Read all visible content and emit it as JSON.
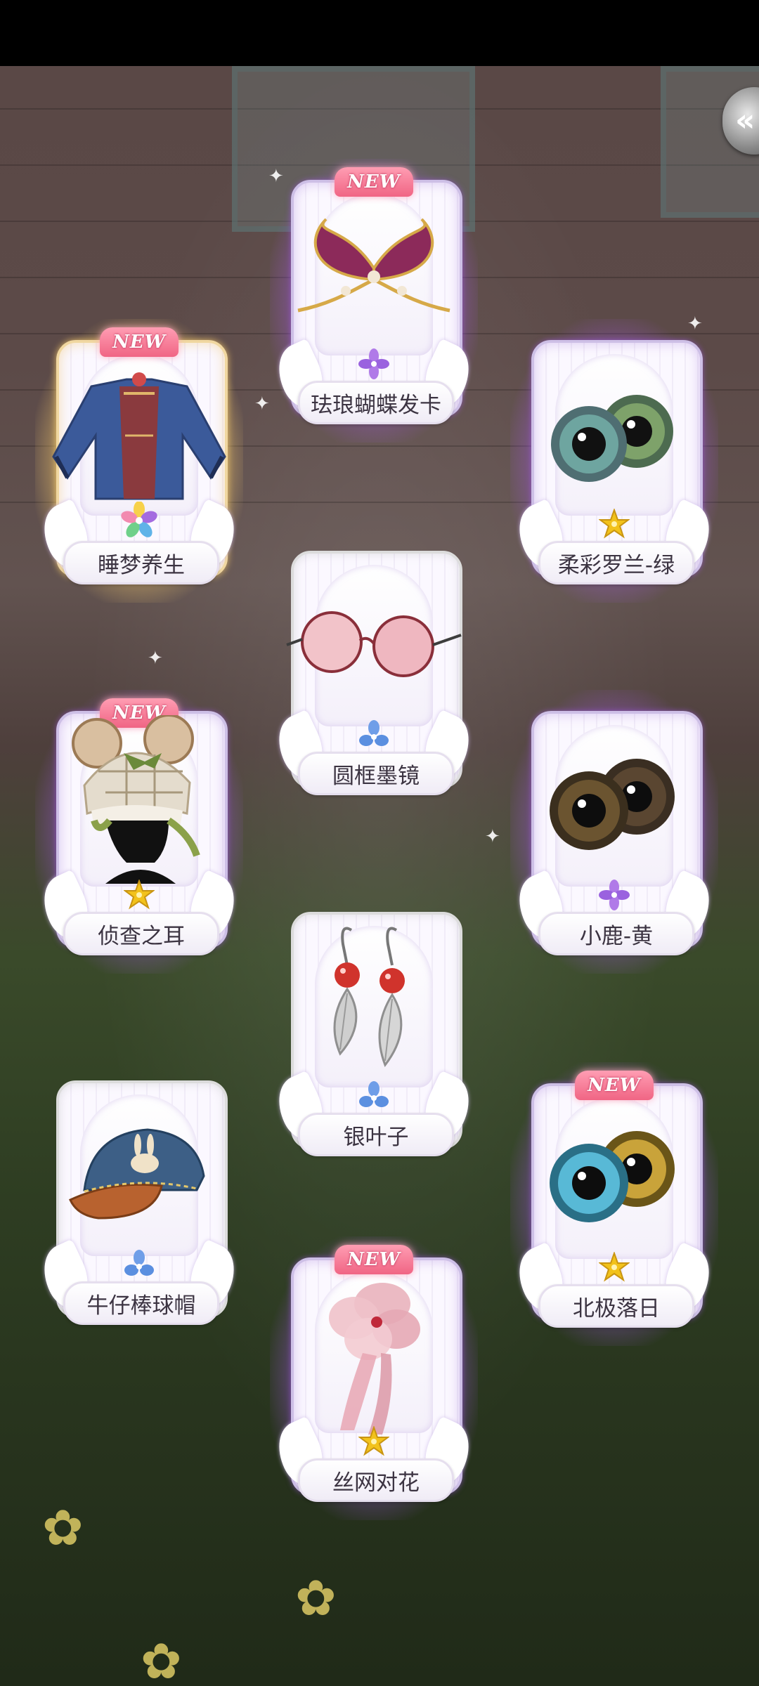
{
  "screen": "item-reward-results",
  "colors": {
    "rarity_purple": "#a86be6",
    "rarity_blue": "#5b8fe0",
    "rarity_gold": "#f2c21b",
    "new_badge": "#f06584",
    "glow_purple": "#b56ef5",
    "glow_gold": "#ffd36a"
  },
  "back_button": {
    "icon": "double-chevron-left-icon"
  },
  "items": [
    {
      "name": "睡梦养生",
      "new": "NEW",
      "rarity": "rainbow-flower-icon",
      "art": "blue-robe-outfit"
    },
    {
      "name": "珐琅蝴蝶发卡",
      "new": "NEW",
      "rarity": "purple-flower-icon",
      "art": "butterfly-hairpin"
    },
    {
      "name": "柔彩罗兰-绿",
      "new": "",
      "rarity": "gold-star-flower-icon",
      "art": "green-eyes"
    },
    {
      "name": "圆框墨镜",
      "new": "",
      "rarity": "blue-flower-icon",
      "art": "round-sunglasses"
    },
    {
      "name": "侦查之耳",
      "new": "NEW",
      "rarity": "gold-star-flower-icon",
      "art": "plaid-bear-ear-hat"
    },
    {
      "name": "小鹿-黄",
      "new": "",
      "rarity": "purple-flower-icon",
      "art": "brown-eyes"
    },
    {
      "name": "银叶子",
      "new": "",
      "rarity": "blue-flower-icon",
      "art": "silver-leaf-earrings"
    },
    {
      "name": "牛仔棒球帽",
      "new": "",
      "rarity": "blue-flower-icon",
      "art": "denim-bunny-cap"
    },
    {
      "name": "北极落日",
      "new": "NEW",
      "rarity": "gold-star-flower-icon",
      "art": "blue-gold-eyes"
    },
    {
      "name": "丝网对花",
      "new": "NEW",
      "rarity": "gold-star-flower-icon",
      "art": "pink-mesh-flower"
    }
  ]
}
